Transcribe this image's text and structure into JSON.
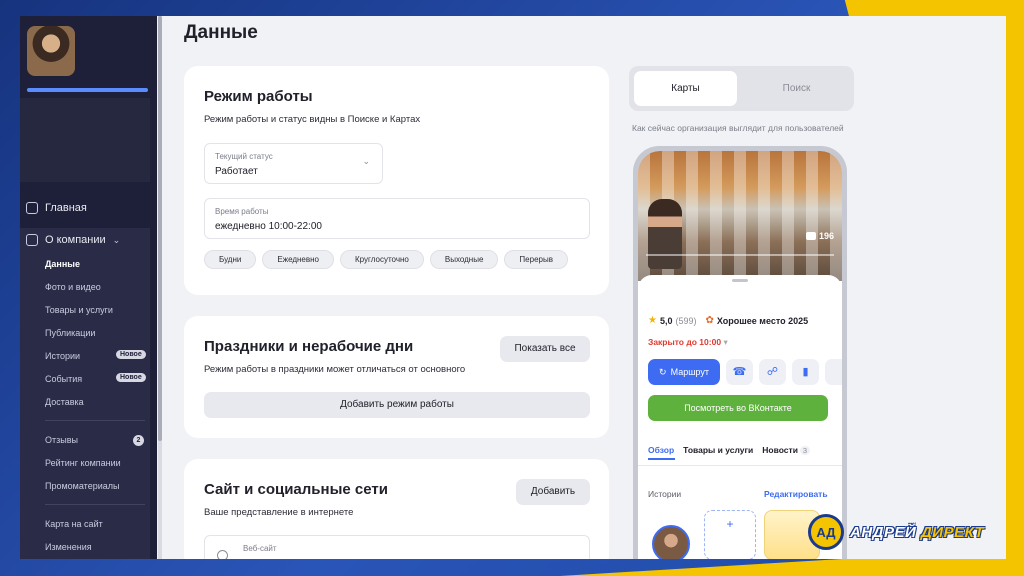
{
  "page": {
    "title": "Данные"
  },
  "sidebar": {
    "home_label": "Главная",
    "about_label": "О компании",
    "items": [
      {
        "label": "Данные",
        "active": true
      },
      {
        "label": "Фото и видео"
      },
      {
        "label": "Товары и услуги"
      },
      {
        "label": "Публикации"
      },
      {
        "label": "Истории",
        "badge": "Новое"
      },
      {
        "label": "События",
        "badge": "Новое"
      },
      {
        "label": "Доставка"
      },
      {
        "label": "Отзывы",
        "badge": "2"
      },
      {
        "label": "Рейтинг компании"
      },
      {
        "label": "Промоматериалы"
      },
      {
        "label": "Карта на сайт"
      },
      {
        "label": "Изменения"
      }
    ]
  },
  "hours": {
    "title": "Режим работы",
    "subtitle": "Режим работы и статус видны в Поиске и Картах",
    "status_label": "Текущий статус",
    "status_value": "Работает",
    "time_label": "Время работы",
    "time_value": "ежедневно 10:00-22:00",
    "chips": [
      "Будни",
      "Ежедневно",
      "Круглосуточно",
      "Выходные",
      "Перерыв"
    ]
  },
  "holidays": {
    "title": "Праздники и нерабочие дни",
    "subtitle": "Режим работы в праздники может отличаться от основного",
    "show_all": "Показать все",
    "add_mode": "Добавить режим работы"
  },
  "social": {
    "title": "Сайт и социальные сети",
    "subtitle": "Ваше представление в интернете",
    "add": "Добавить",
    "website_label": "Веб-сайт"
  },
  "preview": {
    "tabs": [
      "Карты",
      "Поиск"
    ],
    "caption": "Как сейчас организация выглядит для пользователей",
    "photo_count": "196",
    "rating": "5,0",
    "rating_count": "(599)",
    "award": "Хорошее место 2025",
    "closed": "Закрыто до 10:00",
    "route": "Маршрут",
    "vk": "Посмотреть во ВКонтакте",
    "place_tabs": [
      {
        "label": "Обзор",
        "active": true
      },
      {
        "label": "Товары и услуги"
      },
      {
        "label": "Новости",
        "count": "3"
      }
    ],
    "stories_label": "Истории",
    "stories_edit": "Редактировать"
  },
  "brand": {
    "word1": "АНДРЕЙ",
    "word2": "ДИРЕКТ",
    "logo": "АД"
  },
  "colors": {
    "accent": "#3d6cf2",
    "vk_green": "#5fb13d",
    "closed_red": "#e03a2f",
    "brand_yellow": "#f5c400"
  }
}
